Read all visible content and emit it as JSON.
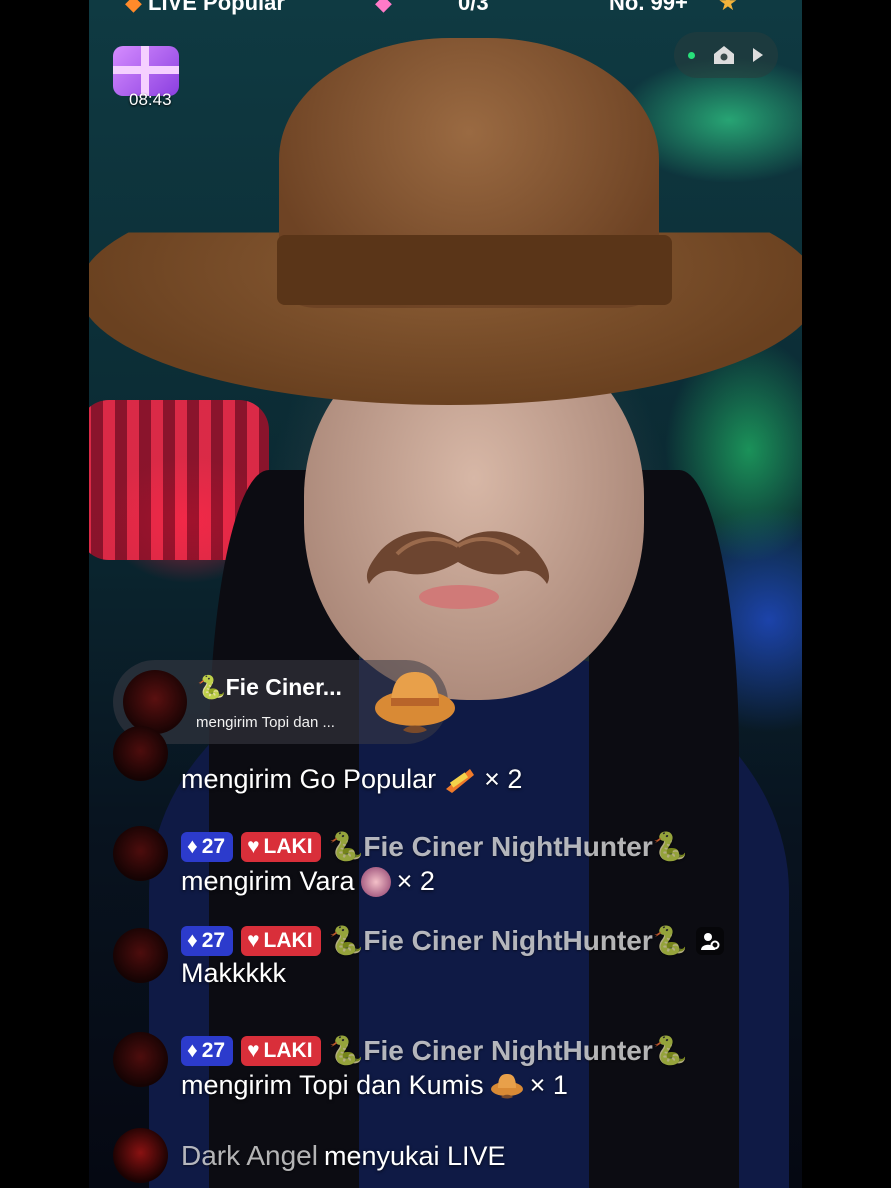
{
  "top_bar": {
    "live_popular": "LIVE Popular",
    "count": "0/3",
    "rank": "No. 99+"
  },
  "timer": {
    "text": "08:43"
  },
  "notification": {
    "name": "🐍Fie Ciner...",
    "subtitle": "mengirim Topi dan ..."
  },
  "chat": [
    {
      "message": "mengirim Go Popular",
      "multiplier": "× 2"
    },
    {
      "level": "27",
      "tag": "LAKI",
      "name": "🐍Fie Ciner NightHunter🐍",
      "message": "mengirim Vara",
      "multiplier": "× 2"
    },
    {
      "level": "27",
      "tag": "LAKI",
      "name": "🐍Fie Ciner NightHunter🐍",
      "message": "Makkkkk"
    },
    {
      "level": "27",
      "tag": "LAKI",
      "name": "🐍Fie Ciner NightHunter🐍",
      "message": "mengirim Topi dan Kumis",
      "multiplier": "× 1"
    },
    {
      "name": "Dark Angel",
      "message": "menyukai LIVE"
    }
  ],
  "icons": [
    "gift-box-icon",
    "home-icon",
    "play-icon",
    "diamond-icon",
    "heart-icon",
    "follow-icon",
    "snake-icon",
    "hat-gift-icon"
  ],
  "colors": {
    "level_badge": "#2c3bcc",
    "laki_badge": "#d92f3a",
    "accent_green": "#27e07a"
  }
}
